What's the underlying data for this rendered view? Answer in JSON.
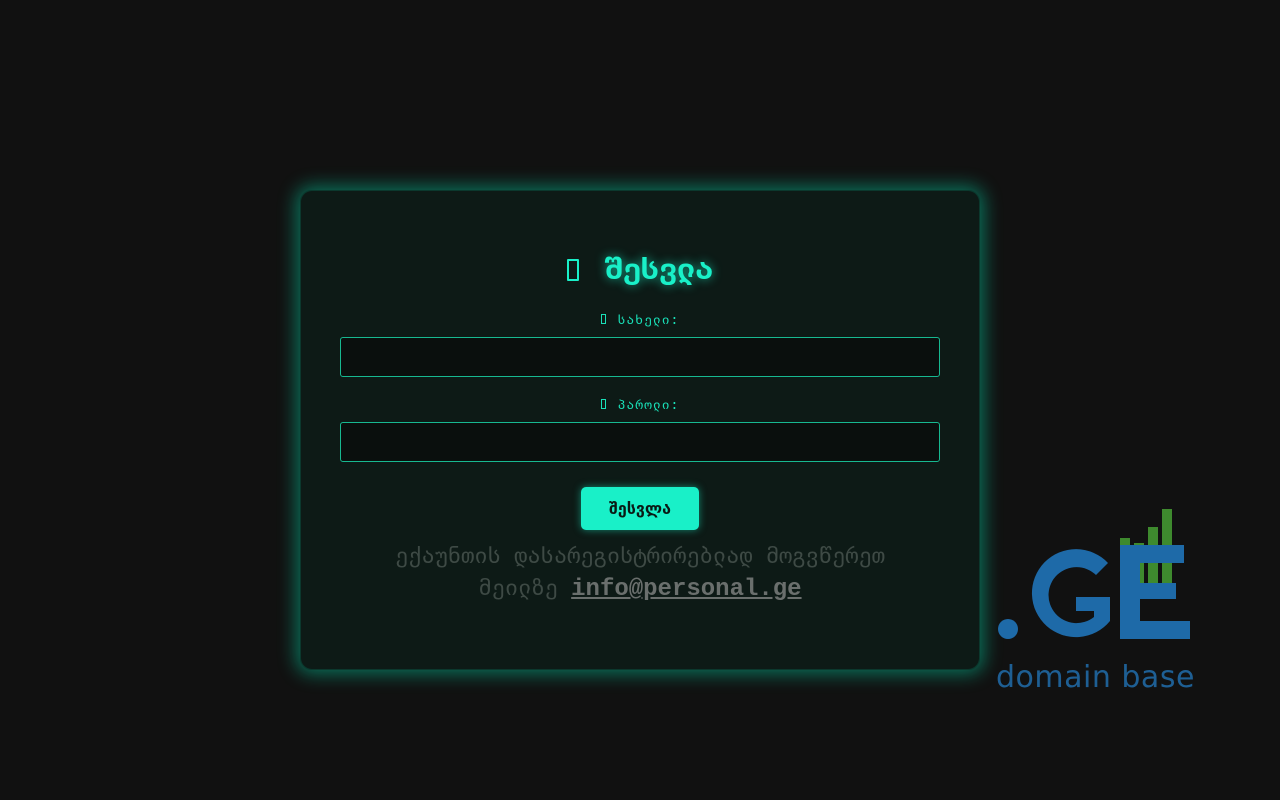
{
  "login": {
    "title": "შესვლა",
    "title_icon": "lock-icon",
    "username_label": "სახელი:",
    "username_icon": "user-icon",
    "username_value": "",
    "password_label": "პაროლი:",
    "password_icon": "key-icon",
    "password_value": "",
    "submit_label": "შესვლა",
    "register_text_line1": "ექაუნთის დასარეგისტრირებლად მოგვწერეთ",
    "register_text_line2_prefix": "მეილზე",
    "register_email": "info@personal.ge"
  },
  "branding": {
    "logo_text": ".GE",
    "tagline": "domain base",
    "logo_color": "#1e6aa8",
    "bars_color": "#3e8a2e"
  },
  "colors": {
    "accent": "#19f0c8",
    "background": "#111111",
    "card": "#0d1a16"
  }
}
